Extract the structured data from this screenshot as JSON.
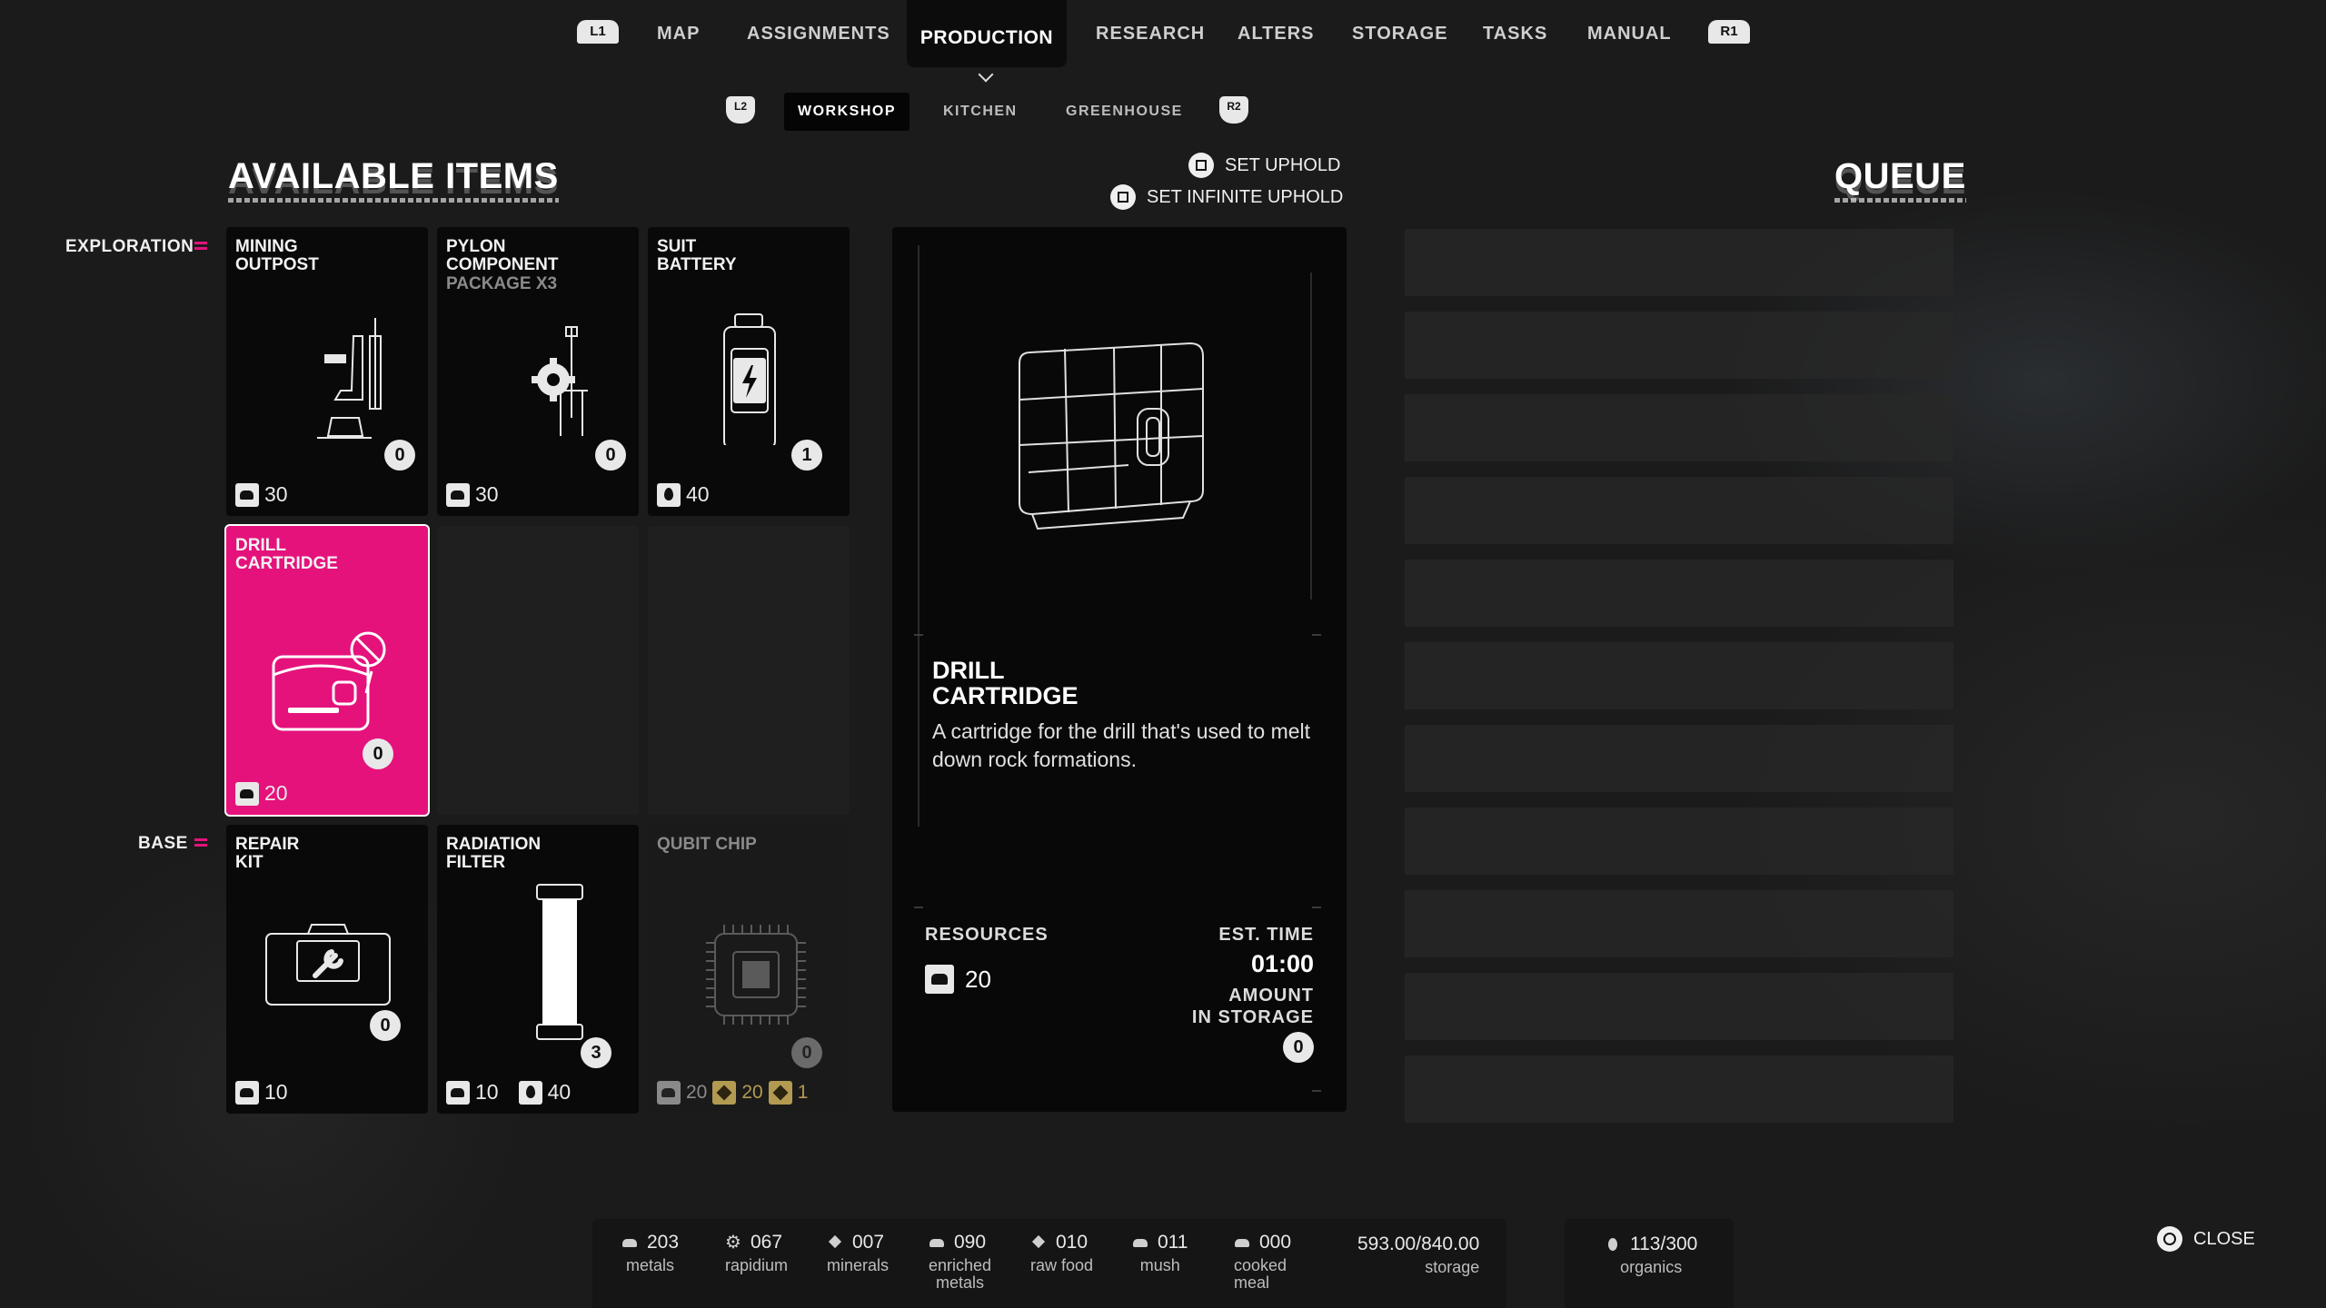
{
  "nav": {
    "left_shoulder": "L1",
    "right_shoulder": "R1",
    "items": [
      "MAP",
      "ASSIGNMENTS",
      "PRODUCTION",
      "RESEARCH",
      "ALTERS",
      "STORAGE",
      "TASKS",
      "MANUAL"
    ],
    "active": "PRODUCTION"
  },
  "subnav": {
    "left_trigger": "L2",
    "right_trigger": "R2",
    "items": [
      "WORKSHOP",
      "KITCHEN",
      "GREENHOUSE"
    ],
    "active": "WORKSHOP"
  },
  "available_title": "AVAILABLE ITEMS",
  "queue_title": "QUEUE",
  "hints": {
    "set_uphold": "SET UPHOLD",
    "set_infinite_uphold": "SET INFINITE UPHOLD",
    "close": "CLOSE"
  },
  "categories": {
    "exploration": "EXPLORATION",
    "base": "BASE"
  },
  "cards": {
    "mining_outpost": {
      "title": "MINING\nOUTPOST",
      "count": "0",
      "cost": "30"
    },
    "pylon": {
      "title": "PYLON\nCOMPONENT",
      "subtitle": "PACKAGE X3",
      "count": "0",
      "cost": "30"
    },
    "suit_battery": {
      "title": "SUIT\nBATTERY",
      "count": "1",
      "cost": "40"
    },
    "drill_cartridge": {
      "title": "DRILL\nCARTRIDGE",
      "count": "0",
      "cost": "20"
    },
    "repair_kit": {
      "title": "REPAIR\nKIT",
      "count": "0",
      "cost": "10"
    },
    "radiation_filter": {
      "title": "RADIATION\nFILTER",
      "count": "3",
      "cost_metal": "10",
      "cost_organic": "40"
    },
    "qubit_chip": {
      "title": "QUBIT CHIP",
      "count": "0",
      "cost_metal": "20",
      "cost_minerals": "20",
      "cost_rapidium": "1"
    }
  },
  "detail": {
    "title": "DRILL\nCARTRIDGE",
    "description": "A cartridge for the drill that's used to melt down rock formations.",
    "resources_label": "RESOURCES",
    "resources_value": "20",
    "est_time_label": "EST. TIME",
    "est_time_value": "01:00",
    "amount_label": "AMOUNT\nIN STORAGE",
    "amount_value": "0"
  },
  "resources": [
    {
      "value": "203",
      "label": "metals",
      "icon": "metal-icon"
    },
    {
      "value": "067",
      "label": "rapidium",
      "icon": "gear-icon"
    },
    {
      "value": "007",
      "label": "minerals",
      "icon": "diamond-icon"
    },
    {
      "value": "090",
      "label": "enriched\nmetals",
      "icon": "enriched-metal-icon"
    },
    {
      "value": "010",
      "label": "raw food",
      "icon": "carrot-icon"
    },
    {
      "value": "011",
      "label": "mush",
      "icon": "bowl-icon"
    },
    {
      "value": "000",
      "label": "cooked\nmeal",
      "icon": "pot-icon"
    }
  ],
  "storage": {
    "value": "593.00/840.00",
    "label": "storage"
  },
  "organics": {
    "value": "113/300",
    "label": "organics"
  },
  "colors": {
    "accent": "#e5127c",
    "panel": "#090909",
    "background": "#1b1b1b"
  }
}
